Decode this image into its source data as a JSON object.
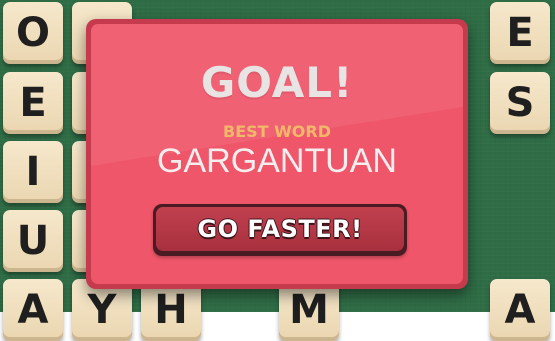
{
  "background_color": "#2f6d46",
  "board": {
    "left_column": [
      "O",
      "E",
      "I",
      "U",
      "A"
    ],
    "second_column": [
      "",
      "",
      "",
      "",
      "Y"
    ],
    "bottom_row_middle": [
      "H",
      "M"
    ],
    "right_column": [
      "E",
      "S",
      "A"
    ]
  },
  "dialog": {
    "title": "GOAL!",
    "best_word_label": "BEST WORD",
    "best_word": "GARGANTUAN",
    "button_label": "GO FASTER!",
    "colors": {
      "panel": "#f0566a",
      "panel_border": "#c53a4c",
      "label": "#f2b86a",
      "button": "#b03645"
    }
  }
}
